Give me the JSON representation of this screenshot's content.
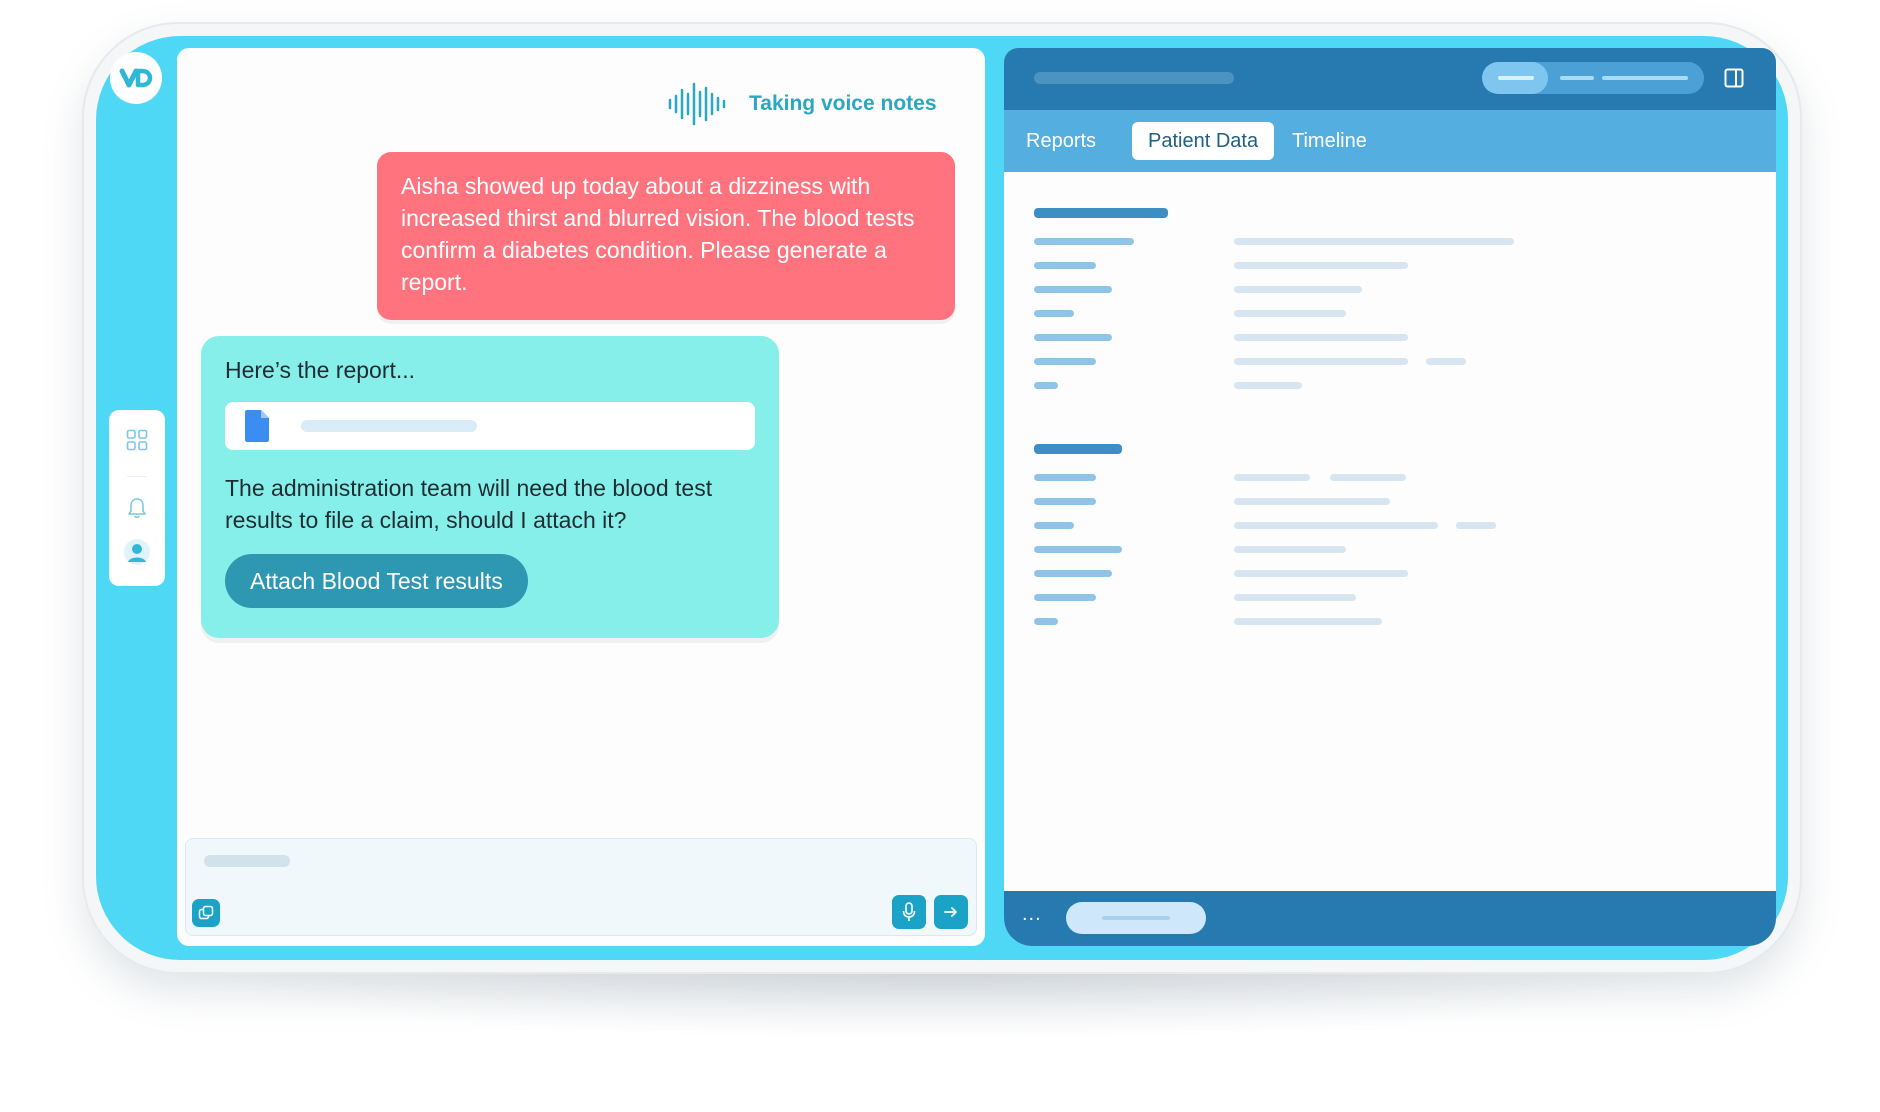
{
  "app": {
    "brand_mark": "VD",
    "colors": {
      "screen": "#4fd8f5",
      "user_bubble": "#ff737f",
      "bot_bubble": "#86efe9",
      "button": "#2e97b1",
      "panel_header": "#277ab0",
      "tab_strip": "#55aee0"
    }
  },
  "rail": {
    "items": [
      {
        "icon": "grid-icon"
      },
      {
        "icon": "bell-icon"
      },
      {
        "icon": "user-avatar-icon"
      }
    ]
  },
  "chat": {
    "voice_status": "Taking voice notes",
    "user_message": "Aisha showed up today about a  dizziness with increased thirst and blurred vision. The blood tests confirm a diabetes condition. Please generate a report.",
    "bot_intro": "Here’s the report...",
    "bot_attachment_icon": "document-icon",
    "bot_question": "The administration team will need the blood test results to file a claim, should I attach it?",
    "attach_button": "Attach Blood Test results",
    "composer": {
      "left_button_icon": "stack-icon",
      "mic_button_icon": "microphone-icon",
      "send_button_icon": "arrow-right-icon"
    }
  },
  "data_panel": {
    "tabs": [
      {
        "label": "Reports",
        "active": false
      },
      {
        "label": "Patient Data",
        "active": true
      },
      {
        "label": "Timeline",
        "active": false
      }
    ],
    "header_icon": "sidebar-toggle-icon",
    "footer": {
      "more_label": "..."
    }
  }
}
